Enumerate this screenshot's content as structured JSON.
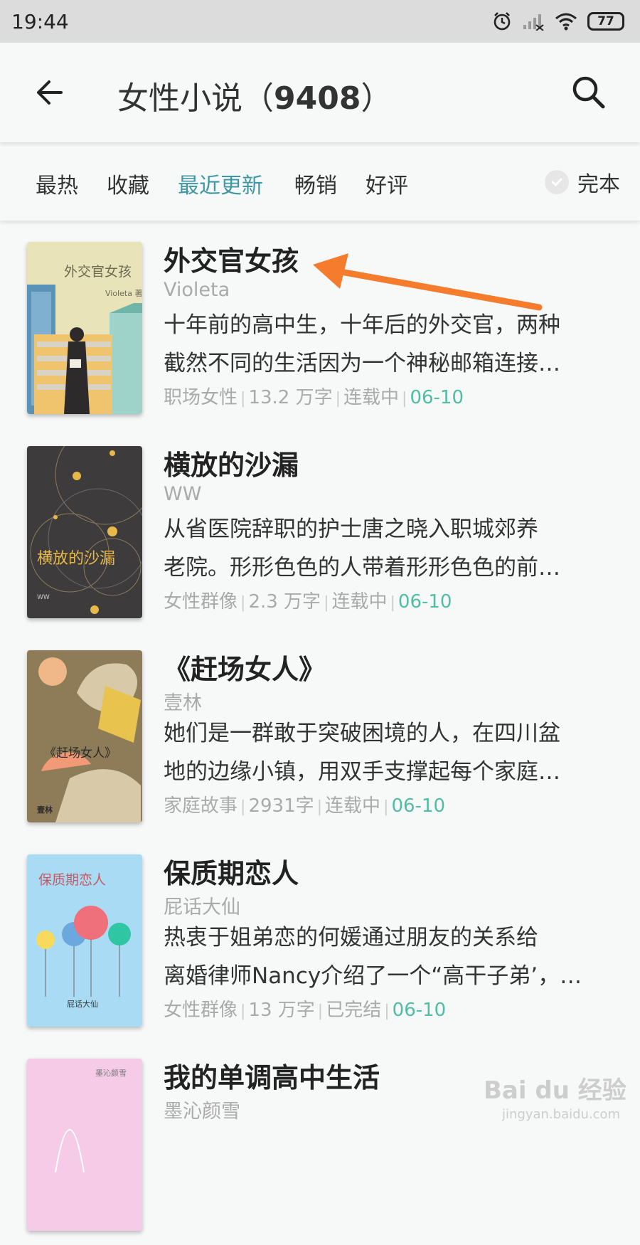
{
  "status": {
    "time": "19:44",
    "battery": "77"
  },
  "header": {
    "title": "女性小说（",
    "count": "9408",
    "title_end": "）"
  },
  "filters": {
    "tabs": [
      {
        "label": "最热"
      },
      {
        "label": "收藏"
      },
      {
        "label": "最近更新"
      },
      {
        "label": "畅销"
      },
      {
        "label": "好评"
      }
    ],
    "active": "最近更新",
    "complete_label": "完本"
  },
  "books": [
    {
      "title": "外交官女孩",
      "author": "Violeta",
      "desc1": "十年前的高中生，十年后的外交官，两种",
      "desc2": "截然不同的生活因为一个神秘邮箱连接…",
      "category": "职场女性",
      "words": "13.2 万字",
      "status": "连载中",
      "date": "06-10",
      "cover_title": "外交官女孩",
      "cover_author": "Violeta 著"
    },
    {
      "title": "横放的沙漏",
      "author": "WW",
      "desc1": "从省医院辞职的护士唐之晓入职城郊养",
      "desc2": "老院。形形色色的人带着形形色色的前…",
      "category": "女性群像",
      "words": "2.3 万字",
      "status": "连载中",
      "date": "06-10",
      "cover_title": "横放的沙漏",
      "cover_author": "WW"
    },
    {
      "title": "《赶场女人》",
      "author": "壹林",
      "desc1": "她们是一群敢于突破困境的人，在四川盆",
      "desc2": "地的边缘小镇，用双手支撑起每个家庭…",
      "category": "家庭故事",
      "words": "2931字",
      "status": "连载中",
      "date": "06-10",
      "cover_title": "《赶场女人》",
      "cover_author": "壹林"
    },
    {
      "title": "保质期恋人",
      "author": "屁话大仙",
      "desc1": "热衷于姐弟恋的何媛通过朋友的关系给",
      "desc2": "离婚律师Nancy介绍了一个“高干子弟’，…",
      "category": "女性群像",
      "words": "13 万字",
      "status": "已完结",
      "date": "06-10",
      "cover_title": "保质期恋人",
      "cover_author": "屁话大仙"
    },
    {
      "title": "我的单调高中生活",
      "author": "墨沁颜雪",
      "cover_author": "墨沁颜雪"
    }
  ],
  "watermark": {
    "main": "Bai du 经验",
    "sub": "jingyan.baidu.com"
  },
  "colors": {
    "accent": "#3f97a6",
    "date": "#4fbea3",
    "arrow": "#f47c2c"
  }
}
